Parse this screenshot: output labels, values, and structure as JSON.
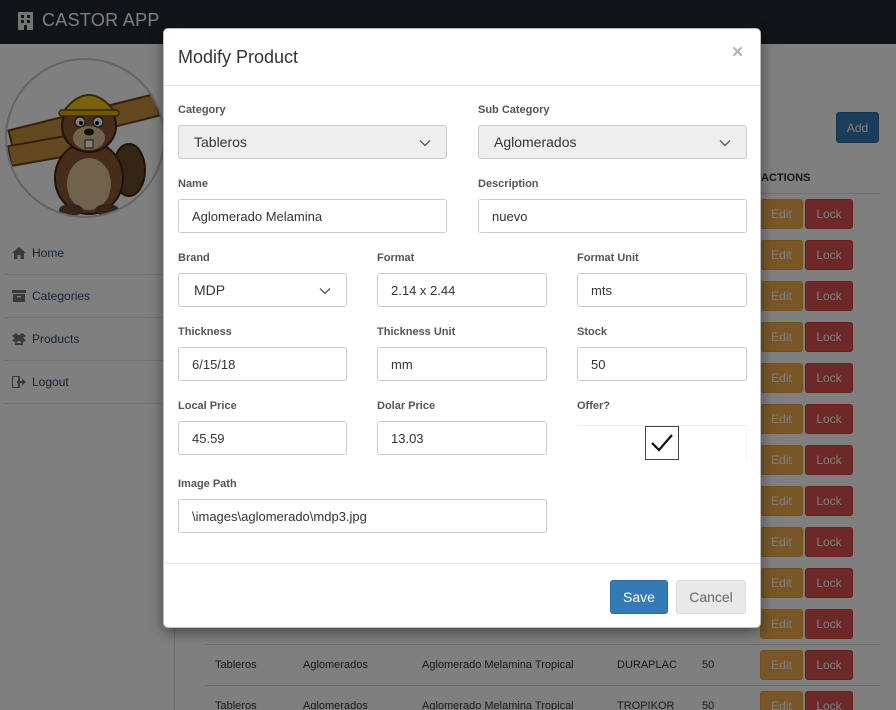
{
  "app": {
    "title": "CASTOR APP"
  },
  "sidebar": {
    "items": [
      {
        "label": "Home",
        "icon": "home-icon"
      },
      {
        "label": "Categories",
        "icon": "categories-icon"
      },
      {
        "label": "Products",
        "icon": "products-icon"
      },
      {
        "label": "Logout",
        "icon": "logout-icon"
      }
    ]
  },
  "main": {
    "add_label": "Add",
    "actions_header": "ACTIONS",
    "edit_label": "Edit",
    "lock_label": "Lock",
    "rows": [
      {
        "category": "Tableros",
        "subcategory": "Aglomerados",
        "name": "Aglomerado Melamina Tropical",
        "brand": "DURAPLAC",
        "stock": "50"
      },
      {
        "category": "Tableros",
        "subcategory": "Aglomerados",
        "name": "Aglomerado Melamina Tropical",
        "brand": "TROPIKOR",
        "stock": "50"
      }
    ]
  },
  "modal": {
    "title": "Modify Product",
    "close": "×",
    "fields": {
      "category": {
        "label": "Category",
        "value": "Tableros"
      },
      "subcategory": {
        "label": "Sub Category",
        "value": "Aglomerados"
      },
      "name": {
        "label": "Name",
        "value": "Aglomerado Melamina"
      },
      "description": {
        "label": "Description",
        "value": "nuevo"
      },
      "brand": {
        "label": "Brand",
        "value": "MDP"
      },
      "format": {
        "label": "Format",
        "value": "2.14 x 2.44"
      },
      "format_unit": {
        "label": "Format Unit",
        "value": "mts"
      },
      "thickness": {
        "label": "Thickness",
        "value": "6/15/18"
      },
      "thickness_unit": {
        "label": "Thickness Unit",
        "value": "mm"
      },
      "stock": {
        "label": "Stock",
        "value": "50"
      },
      "local_price": {
        "label": "Local Price",
        "value": "45.59"
      },
      "dolar_price": {
        "label": "Dolar Price",
        "value": "13.03"
      },
      "offer": {
        "label": "Offer?",
        "checked": true
      },
      "image_path": {
        "label": "Image Path",
        "value": "\\images\\aglomerado\\mdp3.jpg"
      }
    },
    "save_label": "Save",
    "cancel_label": "Cancel"
  },
  "colors": {
    "primary": "#337ab7",
    "warning": "#f0ad4e",
    "danger": "#d9534f",
    "topbar": "#222a33"
  }
}
